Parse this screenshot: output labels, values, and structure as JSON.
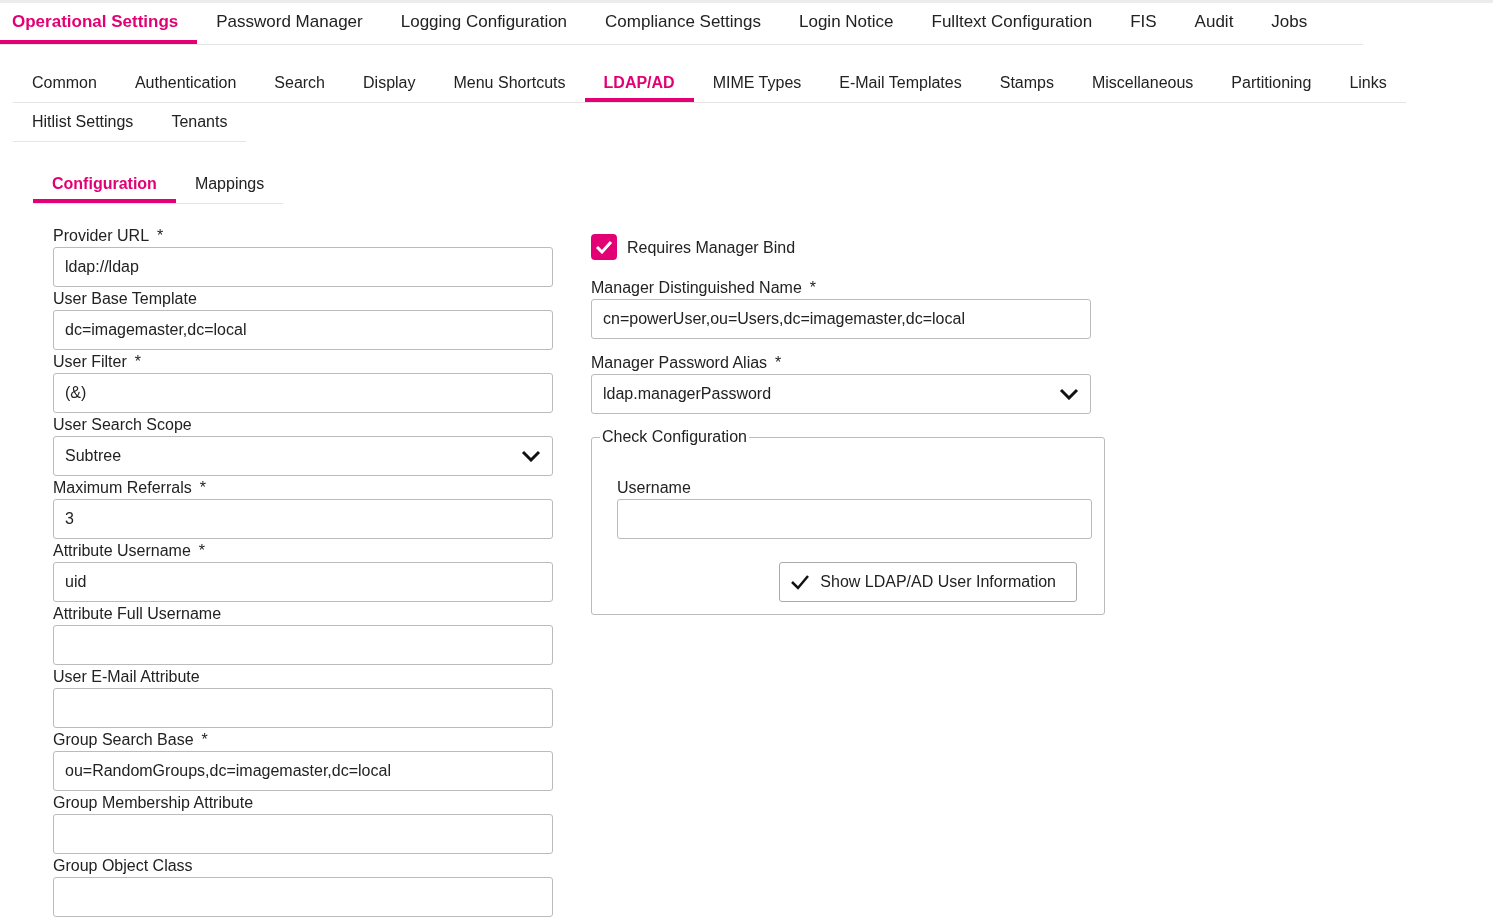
{
  "main_tabs": [
    {
      "label": "Operational Settings",
      "selected": true
    },
    {
      "label": "Password Manager",
      "selected": false
    },
    {
      "label": "Logging Configuration",
      "selected": false
    },
    {
      "label": "Compliance Settings",
      "selected": false
    },
    {
      "label": "Login Notice",
      "selected": false
    },
    {
      "label": "Fulltext Configuration",
      "selected": false
    },
    {
      "label": "FIS",
      "selected": false
    },
    {
      "label": "Audit",
      "selected": false
    },
    {
      "label": "Jobs",
      "selected": false
    }
  ],
  "sub_tab_rows": [
    [
      {
        "label": "Common",
        "selected": false
      },
      {
        "label": "Authentication",
        "selected": false
      },
      {
        "label": "Search",
        "selected": false
      },
      {
        "label": "Display",
        "selected": false
      },
      {
        "label": "Menu Shortcuts",
        "selected": false
      },
      {
        "label": "LDAP/AD",
        "selected": true
      },
      {
        "label": "MIME Types",
        "selected": false
      },
      {
        "label": "E-Mail Templates",
        "selected": false
      },
      {
        "label": "Stamps",
        "selected": false
      },
      {
        "label": "Miscellaneous",
        "selected": false
      },
      {
        "label": "Partitioning",
        "selected": false
      },
      {
        "label": "Links",
        "selected": false
      }
    ],
    [
      {
        "label": "Hitlist Settings",
        "selected": false
      },
      {
        "label": "Tenants",
        "selected": false
      }
    ]
  ],
  "section_tabs": [
    {
      "label": "Configuration",
      "selected": true
    },
    {
      "label": "Mappings",
      "selected": false
    }
  ],
  "left_fields": [
    {
      "kind": "text",
      "label": "Provider URL",
      "required_mark": "*",
      "value": "ldap://ldap"
    },
    {
      "kind": "text",
      "label": "User Base Template",
      "value": "dc=imagemaster,dc=local"
    },
    {
      "kind": "text",
      "label": "User Filter",
      "required_mark": "*",
      "value": "(&)"
    },
    {
      "kind": "select",
      "label": "User Search Scope",
      "value": "Subtree"
    },
    {
      "kind": "text",
      "label": "Maximum Referrals",
      "required_mark": "*",
      "value": "3"
    },
    {
      "kind": "text",
      "label": "Attribute Username",
      "required_mark": "*",
      "value": "uid"
    },
    {
      "kind": "text",
      "label": "Attribute Full Username"
    },
    {
      "kind": "text",
      "label": "User E-Mail Attribute"
    },
    {
      "kind": "text",
      "label": "Group Search Base",
      "required_mark": "*",
      "value": "ou=RandomGroups,dc=imagemaster,dc=local"
    },
    {
      "kind": "text",
      "label": "Group Membership Attribute"
    },
    {
      "kind": "text",
      "label": "Group Object Class"
    }
  ],
  "requires_manager_bind": {
    "label": "Requires Manager Bind",
    "checked": true
  },
  "right_fields": [
    {
      "kind": "text",
      "label": "Manager Distinguished Name",
      "required_mark": "*",
      "value": "cn=powerUser,ou=Users,dc=imagemaster,dc=local"
    },
    {
      "kind": "select",
      "label": "Manager Password Alias",
      "required_mark": "*",
      "value": "ldap.managerPassword"
    }
  ],
  "check_configuration": {
    "legend": "Check Configuration",
    "username_label": "Username",
    "button": "Show LDAP/AD User Information"
  }
}
